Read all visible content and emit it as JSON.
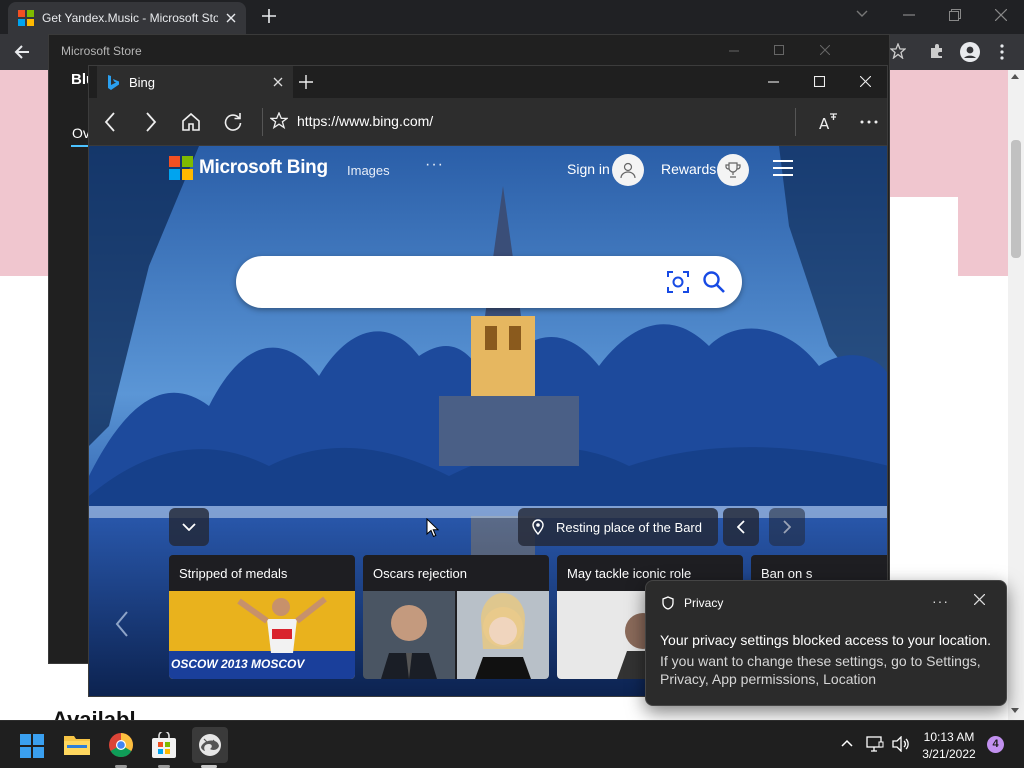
{
  "chrome": {
    "tab_title": "Get Yandex.Music - Microsoft Store",
    "page_left_text": "Blu",
    "page_tab_text": "Ov",
    "page_bottom_text": "Availabl"
  },
  "store": {
    "title": "Microsoft Store"
  },
  "edge": {
    "tab_title": "Bing",
    "url": "https://www.bing.com/"
  },
  "bing": {
    "brand": "Microsoft Bing",
    "images_link": "Images",
    "more": "···",
    "signin": "Sign in",
    "rewards": "Rewards",
    "image_caption": "Resting place of the Bard",
    "news": [
      {
        "title": "Stripped of medals",
        "image_text": "OSCOW 2013 MOSCOV"
      },
      {
        "title": "Oscars rejection"
      },
      {
        "title": "May tackle iconic role"
      },
      {
        "title": "Ban on s"
      }
    ]
  },
  "toast": {
    "title": "Privacy",
    "more": "···",
    "heading": "Your privacy settings blocked access to your location.",
    "body": "If you want to change these settings, go to Settings, Privacy, App permissions, Location"
  },
  "taskbar": {
    "time": "10:13 AM",
    "date": "3/21/2022",
    "notification_count": "4",
    "apps": [
      "start-icon",
      "file-explorer-icon",
      "chrome-icon",
      "microsoft-store-icon",
      "edge-icon"
    ]
  },
  "colors": {
    "accent_blue": "#4cc2ff",
    "taskbar": "#1f1f1f",
    "badge": "#c291ef",
    "banner_pink": "#f0c6cf"
  }
}
